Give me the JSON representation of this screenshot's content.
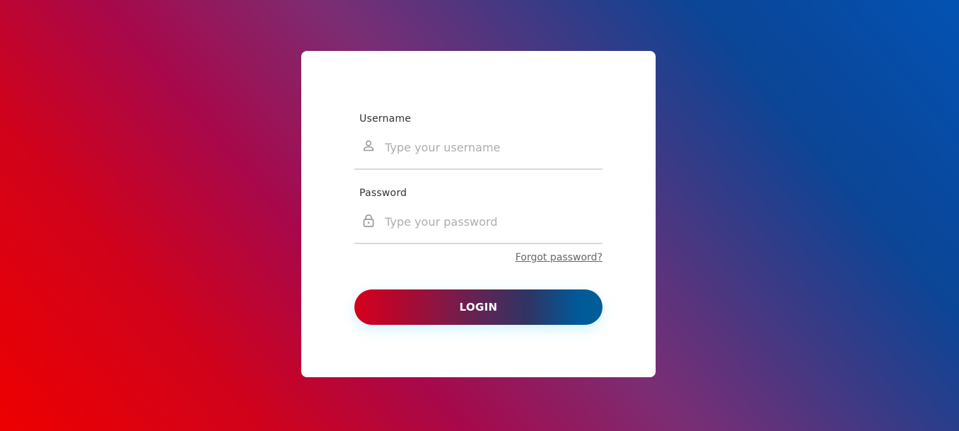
{
  "form": {
    "username": {
      "label": "Username",
      "placeholder": "Type your username",
      "icon": "person-icon"
    },
    "password": {
      "label": "Password",
      "placeholder": "Type your password",
      "icon": "lock-icon"
    },
    "forgot_label": "Forgot password?",
    "login_label": "LOGIN"
  },
  "colors": {
    "button_gradient_start": "#d6001c",
    "button_gradient_end": "#005e96",
    "input_underline": "#d9d9d9",
    "placeholder": "#adadad"
  }
}
